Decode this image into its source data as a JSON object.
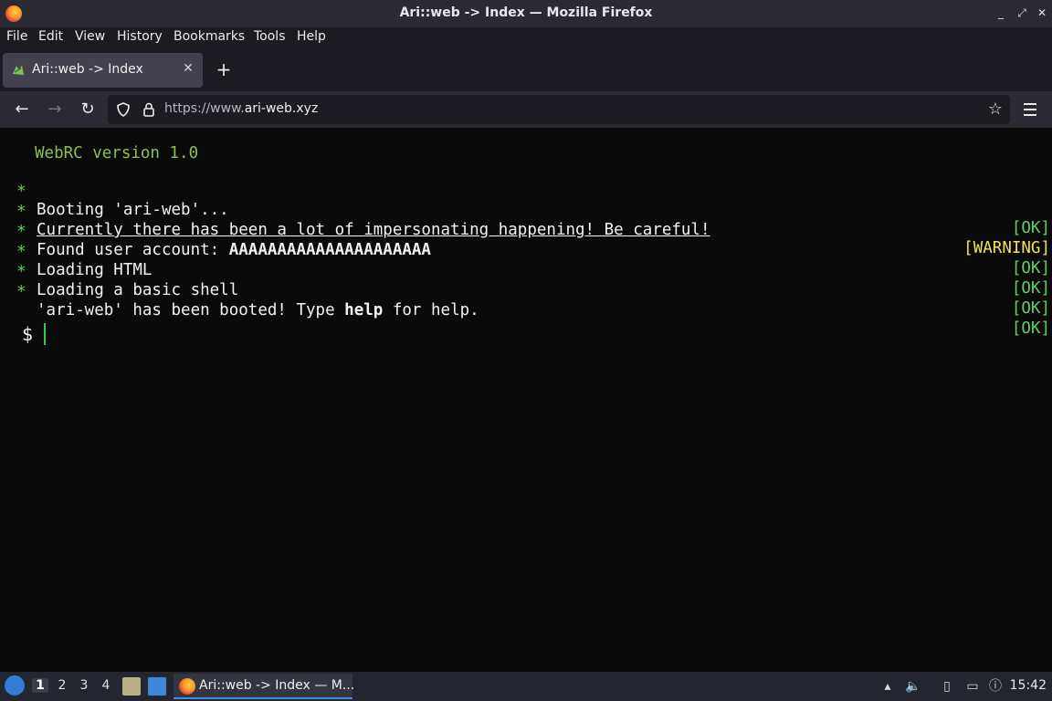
{
  "window": {
    "title": "Ari::web -> Index — Mozilla Firefox",
    "controls": [
      "_",
      "⤢",
      "✕"
    ]
  },
  "menu": {
    "items": [
      {
        "label": "File"
      },
      {
        "label": "Edit"
      },
      {
        "label": "View"
      },
      {
        "label": "History"
      },
      {
        "label": "Bookmarks"
      },
      {
        "label": "Tools"
      },
      {
        "label": "Help"
      }
    ]
  },
  "tabs": {
    "active": {
      "label": "Ari::web -> Index",
      "close": "✕"
    },
    "new_tab": "+"
  },
  "navbar": {
    "url_prefix": "https://www.",
    "url_host": "ari-web.xyz"
  },
  "terminal": {
    "version": "WebRC version 1.0",
    "bullet": "*",
    "lines": [
      {
        "pre": "Booting 'ari-web'...",
        "status": "[OK]"
      },
      {
        "pre": "Currently there has been a lot of impersonating happening! Be careful!",
        "status": "[WARNING]"
      },
      {
        "pre": "Found user account: ",
        "bold": "AAAAAAAAAAAAAAAAAAAAA",
        "status": "[OK]"
      },
      {
        "pre": "Loading HTML",
        "status": "[OK]"
      },
      {
        "pre": "Loading a basic shell",
        "status": "[OK]"
      },
      {
        "pre": "'ari-web' has been booted! Type ",
        "bold": "help",
        "post": " for help.",
        "status": "[OK]"
      }
    ],
    "prompt": "$"
  },
  "taskbar": {
    "workspaces": [
      "1",
      "2",
      "3",
      "4"
    ],
    "task_label": "Ari::web -> Index — M...",
    "clock": "15:42"
  },
  "colors": {
    "ok": "#5fd05f",
    "warning": "#f0e44c",
    "version": "#8fbf4f"
  }
}
